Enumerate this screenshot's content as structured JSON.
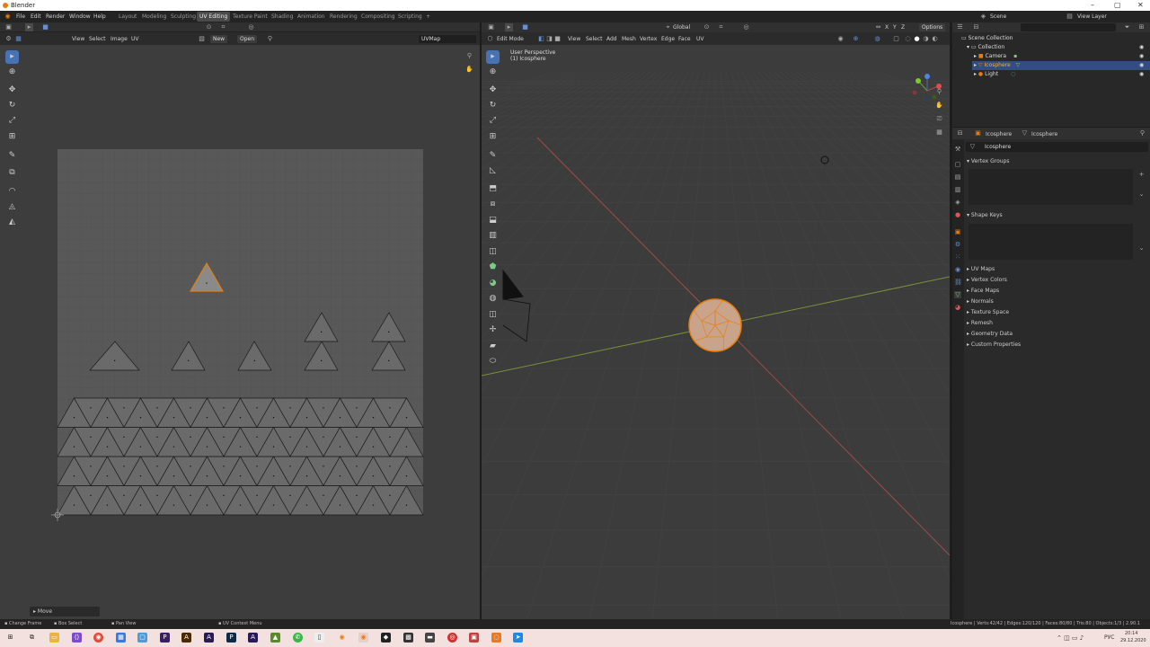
{
  "window": {
    "title": "Blender",
    "controls": [
      "–",
      "▢",
      "✕"
    ]
  },
  "menubar": {
    "menus": [
      "File",
      "Edit",
      "Render",
      "Window",
      "Help"
    ],
    "workspaces": [
      "Layout",
      "Modeling",
      "Sculpting",
      "UV Editing",
      "Texture Paint",
      "Shading",
      "Animation",
      "Rendering",
      "Compositing",
      "Scripting"
    ],
    "active_workspace": "UV Editing",
    "add_tab": "+",
    "scene": "Scene",
    "view_layer": "View Layer"
  },
  "uv_editor": {
    "menus": [
      "View",
      "Select",
      "Image",
      "UV"
    ],
    "new_button": "New",
    "open_button": "Open",
    "uvmap": "UVMap",
    "operator_panel": "Move"
  },
  "viewport": {
    "mode": "Edit Mode",
    "menus": [
      "View",
      "Select",
      "Add",
      "Mesh",
      "Vertex",
      "Edge",
      "Face",
      "UV"
    ],
    "orientation": "Global",
    "options": "Options",
    "axes_lock": [
      "X",
      "Y",
      "Z"
    ],
    "overlay_line1": "User Perspective",
    "overlay_line2": "(1) Icosphere"
  },
  "outliner": {
    "search_placeholder": "",
    "items": [
      {
        "label": "Scene Collection",
        "indent": 0
      },
      {
        "label": "Collection",
        "indent": 1
      },
      {
        "label": "Camera",
        "indent": 2
      },
      {
        "label": "Icosphere",
        "indent": 2,
        "selected": true
      },
      {
        "label": "Light",
        "indent": 2
      }
    ]
  },
  "properties": {
    "breadcrumb_object": "Icosphere",
    "breadcrumb_data": "Icosphere",
    "datablock_name": "Icosphere",
    "vertex_groups": "Vertex Groups",
    "shape_keys": "Shape Keys",
    "sections": [
      "UV Maps",
      "Vertex Colors",
      "Face Maps",
      "Normals",
      "Texture Space",
      "Remesh",
      "Geometry Data",
      "Custom Properties"
    ]
  },
  "statusbar": {
    "items": [
      "Change Frame",
      "Box Select",
      "Pan View",
      "UV Context Menu"
    ],
    "stats": "Icosphere | Verts:42/42 | Edges:120/120 | Faces:80/80 | Tris:80 | Objects:1/3 | 2.90.1"
  },
  "taskbar": {
    "lang": "РУС",
    "time": "20:14",
    "date": "29.12.2020"
  },
  "colors": {
    "accent": "#4772b3",
    "orange": "#e87d0d",
    "grid_bg": "#5a5a5a"
  }
}
